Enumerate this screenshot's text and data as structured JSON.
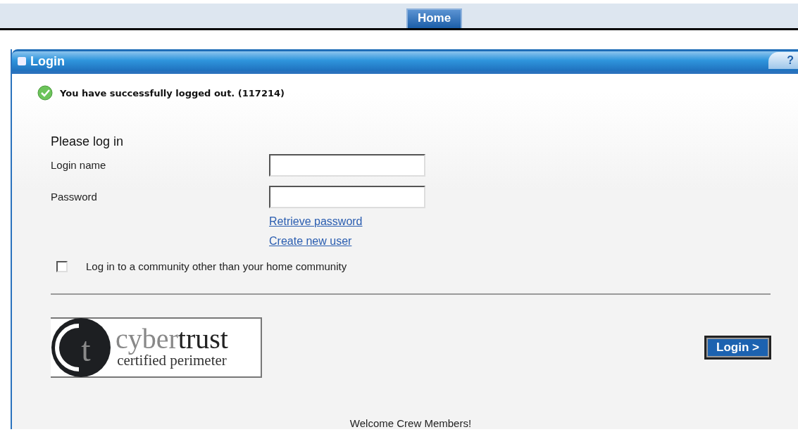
{
  "nav": {
    "tabs": [
      {
        "label": "Home",
        "selected": true
      }
    ]
  },
  "panel": {
    "title": "Login",
    "help": "?"
  },
  "message": {
    "text": "You have successfully logged out. (117214)"
  },
  "form": {
    "heading": "Please log in",
    "fields": [
      {
        "label": "Login name"
      },
      {
        "label": "Password"
      }
    ],
    "links": [
      "Retrieve password",
      "Create new user"
    ],
    "community": {
      "label": "Log in to a community other than your home community",
      "checked": false
    }
  },
  "logo": {
    "mark": "t",
    "name_light": "cyber",
    "name_dark": "trust",
    "tagline": "certified perimeter"
  },
  "login_button": "Login >",
  "footer": "Welcome Crew Members!"
}
